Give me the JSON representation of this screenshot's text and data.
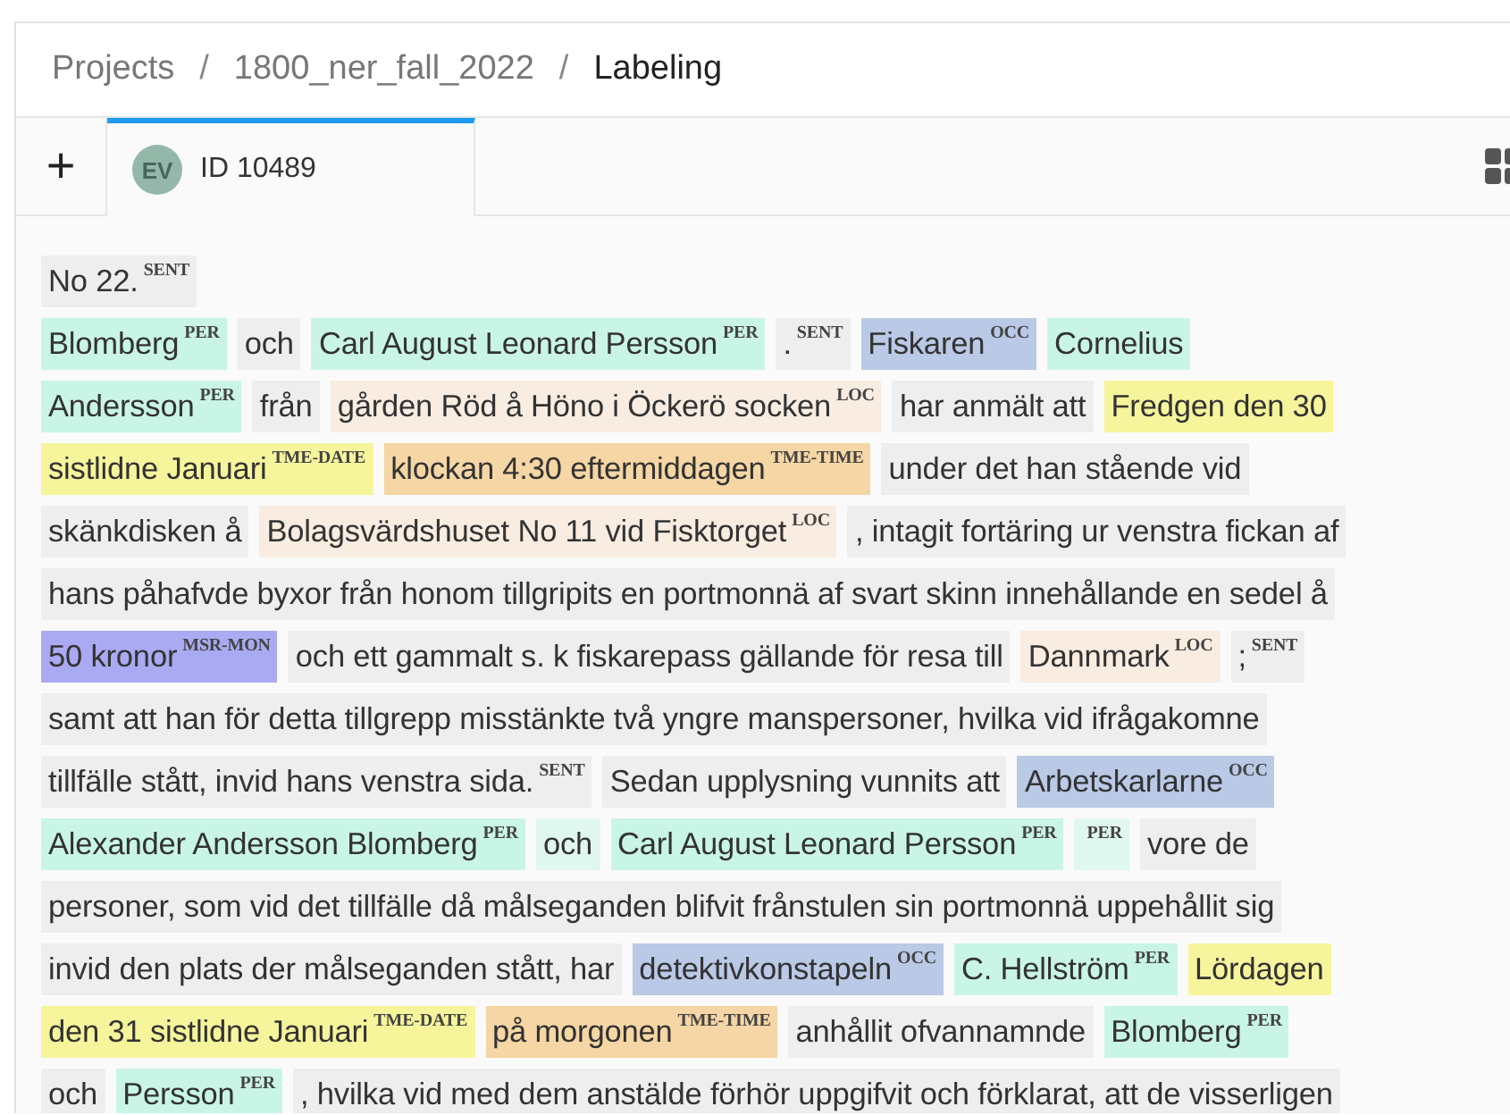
{
  "breadcrumb": [
    {
      "label": "Projects",
      "current": false
    },
    {
      "separator": "/",
      "label": "1800_ner_fall_2022",
      "current": false
    },
    {
      "separator": "/",
      "label": "Labeling",
      "current": true
    }
  ],
  "add_tab": "+",
  "tabs": [
    {
      "avatar": "EV",
      "label": "ID 10489",
      "selected": true
    }
  ],
  "lines": [
    {
      "segments": [
        {
          "text": "No 22.",
          "tag": "SENT"
        }
      ]
    },
    {
      "segments": [
        {
          "text": "Blomberg",
          "tag": "PER",
          "color": "#c9f5e6"
        },
        {
          "text": "och"
        },
        {
          "text": "Carl August Leonard Persson",
          "tag": "PER",
          "color": "#c9f5e6"
        },
        {
          "text": ".",
          "tag": "SENT"
        },
        {
          "text": "Fiskaren",
          "tag": "OCC",
          "color": "#b9c9e6"
        },
        {
          "text": "Cornelius",
          "color": "#c9f5e6"
        }
      ]
    },
    {
      "segments": [
        {
          "text": "Andersson",
          "tag": "PER",
          "color": "#c9f5e6"
        },
        {
          "text": "från"
        },
        {
          "text": "gården Röd å Höno i Öckerö socken",
          "tag": "LOC",
          "color": "#f9ece1"
        },
        {
          "text": "har anmält att"
        },
        {
          "text": "Fredgen den 30",
          "color": "#f6f59c"
        }
      ]
    },
    {
      "segments": [
        {
          "text": "sistlidne Januari",
          "tag": "TME-DATE",
          "color": "#f6f59c"
        },
        {
          "text": "klockan 4:30 eftermiddagen",
          "tag": "TME-TIME",
          "color": "#f5d6a4"
        },
        {
          "text": "under det han stående vid"
        }
      ]
    },
    {
      "segments": [
        {
          "text": "skänkdisken å"
        },
        {
          "text": "Bolagsvärdshuset No 11 vid Fisktorget",
          "tag": "LOC",
          "color": "#f9ece1"
        },
        {
          "text": ", intagit fortäring ur venstra fickan af"
        }
      ]
    },
    {
      "segments": [
        {
          "text": "hans påhafvde byxor från honom tillgripits en portmonnä af svart skinn innehållande en sedel å"
        }
      ]
    },
    {
      "segments": [
        {
          "text": "50 kronor",
          "tag": "MSR-MON",
          "color": "#aaaaf3"
        },
        {
          "text": "och ett gammalt s. k fiskarepass gällande för resa till"
        },
        {
          "text": "Dannmark",
          "tag": "LOC",
          "color": "#f9ece1"
        },
        {
          "text": ";",
          "tag": "SENT"
        }
      ]
    },
    {
      "segments": [
        {
          "text": "samt att han för detta tillgrepp misstänkte två yngre manspersoner, hvilka vid ifrågakomne"
        }
      ]
    },
    {
      "segments": [
        {
          "text": "tillfälle stått, invid hans venstra sida.",
          "tag": "SENT"
        },
        {
          "text": "Sedan upplysning vunnits att"
        },
        {
          "text": "Arbetskarlarne",
          "tag": "OCC",
          "color": "#b9c9e6"
        }
      ]
    },
    {
      "segments": [
        {
          "text": "Alexander Andersson Blomberg",
          "tag": "PER",
          "color": "#c9f5e6"
        },
        {
          "text": "och",
          "color": "#e0f7ef"
        },
        {
          "text": "Carl August Leonard Persson",
          "tag": "PER",
          "color": "#c9f5e6"
        },
        {
          "tag": "PER",
          "color": "#e0f7ef"
        },
        {
          "text": "vore de"
        }
      ]
    },
    {
      "segments": [
        {
          "text": "personer, som vid det tillfälle då målseganden blifvit frånstulen sin portmonnä uppehållit sig"
        }
      ]
    },
    {
      "segments": [
        {
          "text": "invid den plats der målseganden stått, har"
        },
        {
          "text": "detektivkonstapeln",
          "tag": "OCC",
          "color": "#b9c9e6"
        },
        {
          "text": "C. Hellström",
          "tag": "PER",
          "color": "#c9f5e6"
        },
        {
          "text": "Lördagen",
          "color": "#f6f59c"
        }
      ]
    },
    {
      "segments": [
        {
          "text": "den 31 sistlidne Januari",
          "tag": "TME-DATE",
          "color": "#f6f59c"
        },
        {
          "text": "på morgonen",
          "tag": "TME-TIME",
          "color": "#f5d6a4"
        },
        {
          "text": "anhållit ofvannamnde"
        },
        {
          "text": "Blomberg",
          "tag": "PER",
          "color": "#c9f5e6"
        }
      ]
    },
    {
      "segments": [
        {
          "text": "och"
        },
        {
          "text": "Persson",
          "tag": "PER",
          "color": "#c9f5e6"
        },
        {
          "text": ", hvilka vid med dem anstälde förhör uppgifvit och förklarat, att de visserligen"
        }
      ]
    }
  ]
}
